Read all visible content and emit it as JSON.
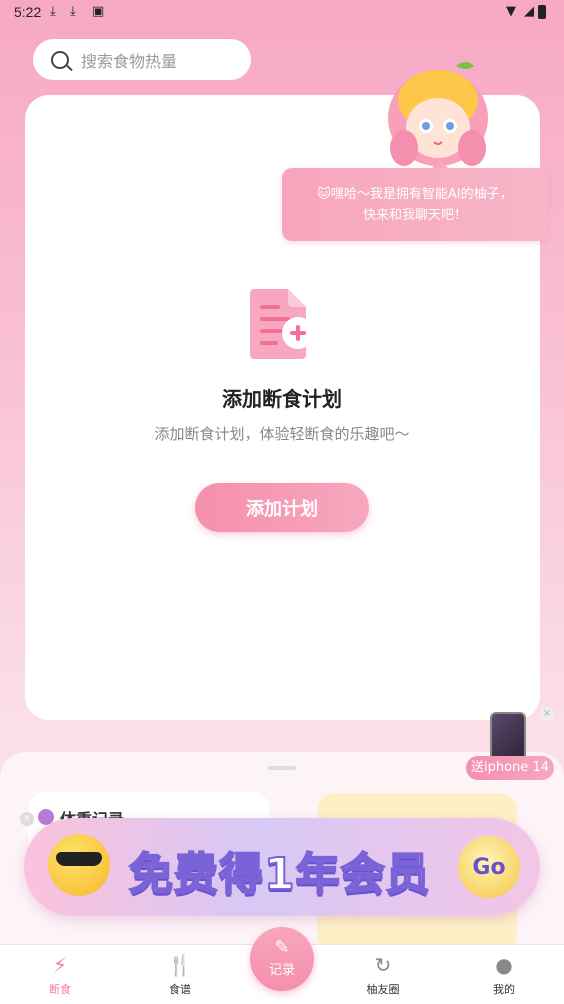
{
  "status_bar": {
    "time": "5:22"
  },
  "search": {
    "placeholder": "搜索食物热量"
  },
  "assistant": {
    "greeting_line1": "🐱嘿哈～我是拥有智能AI的柚子，",
    "greeting_line2": "快来和我聊天吧！"
  },
  "empty_state": {
    "title": "添加断食计划",
    "subtitle": "添加断食计划，体验轻断食的乐趣吧～",
    "button_label": "添加计划"
  },
  "weight_card": {
    "title": "体重记录"
  },
  "promo": {
    "text": "免费得1年会员",
    "go_label": "Go"
  },
  "iphone_promo": {
    "label": "送iphone 14"
  },
  "tab_bar": {
    "items": [
      {
        "label": "断食",
        "icon": "lightning-icon",
        "active": true
      },
      {
        "label": "食谱",
        "icon": "fork-knife-icon",
        "active": false
      },
      {
        "label": "记录",
        "icon": "pencil-icon",
        "active": false
      },
      {
        "label": "柚友圈",
        "icon": "circle-refresh-icon",
        "active": false
      },
      {
        "label": "我的",
        "icon": "user-icon",
        "active": false
      }
    ]
  },
  "colors": {
    "accent": "#f58fae",
    "accent_light": "#f7a7bf",
    "promo_purple": "#6a4fcf"
  }
}
